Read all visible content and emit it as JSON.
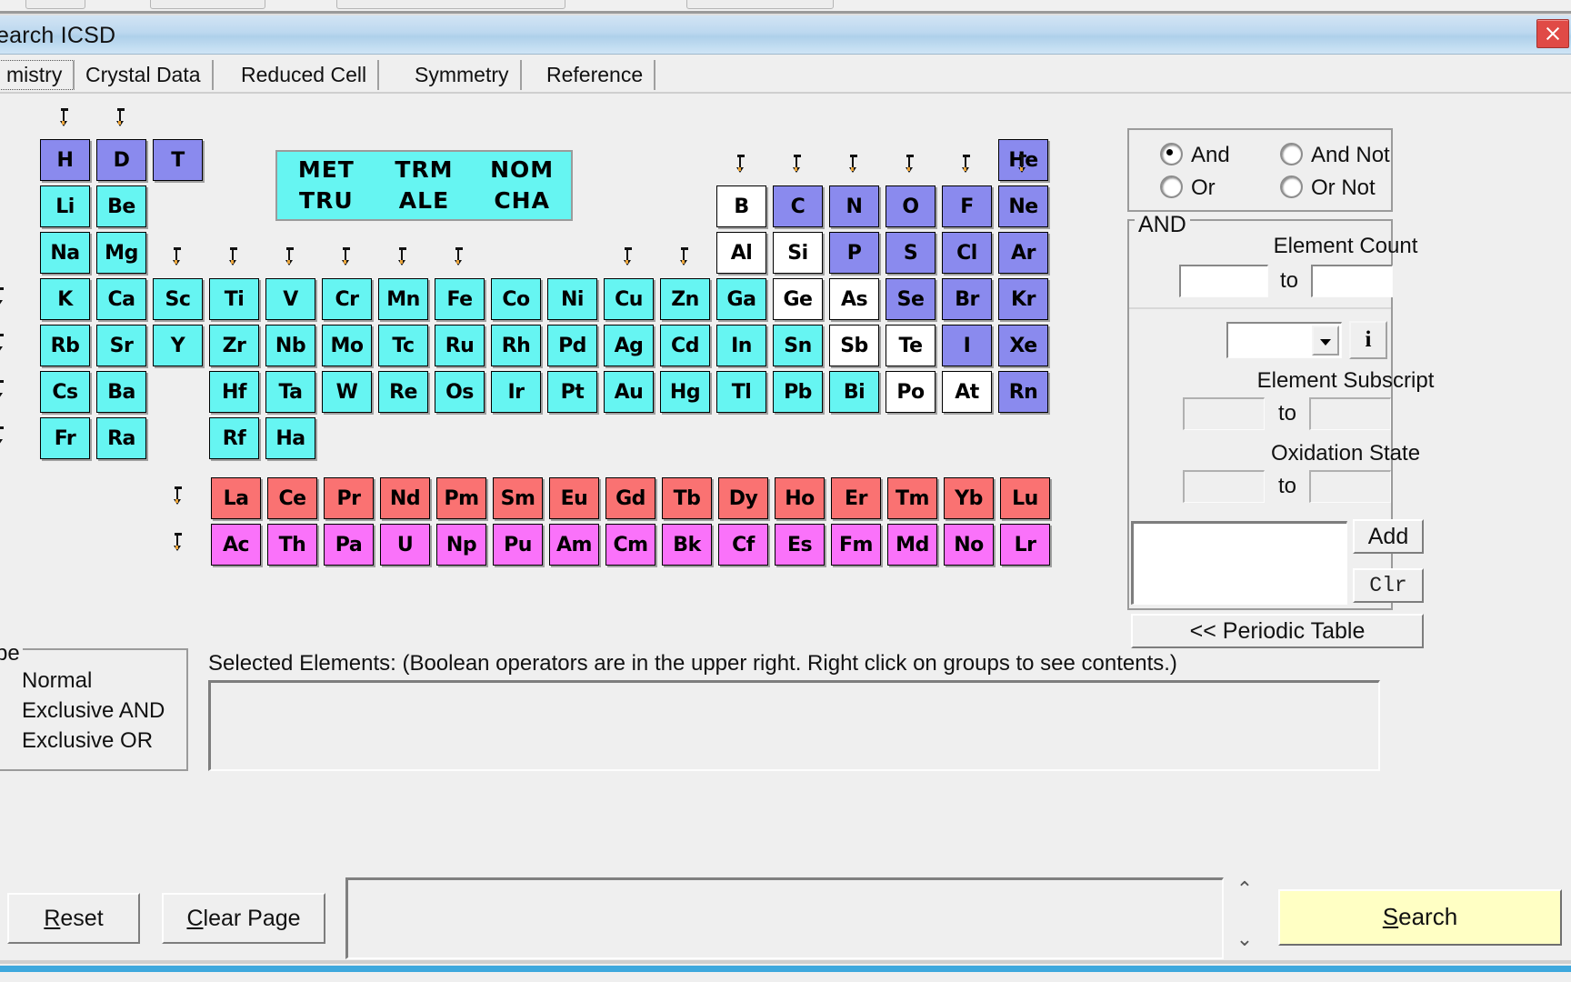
{
  "window": {
    "title": "earch ICSD",
    "close_label": "close-window"
  },
  "tabs": [
    {
      "label": "mistry",
      "selected": true
    },
    {
      "label": "Crystal Data",
      "selected": false
    },
    {
      "label": "Reduced Cell",
      "selected": false
    },
    {
      "label": "Symmetry",
      "selected": false
    },
    {
      "label": "Reference",
      "selected": false
    }
  ],
  "legend": {
    "row1": [
      "MET",
      "TRM",
      "NOM"
    ],
    "row2": [
      "TRU",
      "ALE",
      "CHA"
    ]
  },
  "colors": {
    "cyan": "#66f5f2",
    "blue": "#8a8aee",
    "white": "#ffffff",
    "red": "#fa7272",
    "pink": "#fa72fa",
    "titlebar": "#bcd8ef",
    "search_button": "#ffffc4",
    "close_button": "#e04a46"
  },
  "periodic_table": {
    "rows": [
      {
        "row": 1,
        "cells": [
          {
            "sym": "H",
            "col": 1,
            "color": "blue"
          },
          {
            "sym": "D",
            "col": 2,
            "color": "blue"
          },
          {
            "sym": "T",
            "col": 3,
            "color": "blue"
          },
          {
            "sym": "He",
            "col": 18,
            "color": "blue"
          }
        ]
      },
      {
        "row": 2,
        "cells": [
          {
            "sym": "Li",
            "col": 1,
            "color": "cyan"
          },
          {
            "sym": "Be",
            "col": 2,
            "color": "cyan"
          },
          {
            "sym": "B",
            "col": 13,
            "color": "white"
          },
          {
            "sym": "C",
            "col": 14,
            "color": "blue"
          },
          {
            "sym": "N",
            "col": 15,
            "color": "blue"
          },
          {
            "sym": "O",
            "col": 16,
            "color": "blue"
          },
          {
            "sym": "F",
            "col": 17,
            "color": "blue"
          },
          {
            "sym": "Ne",
            "col": 18,
            "color": "blue"
          }
        ]
      },
      {
        "row": 3,
        "cells": [
          {
            "sym": "Na",
            "col": 1,
            "color": "cyan"
          },
          {
            "sym": "Mg",
            "col": 2,
            "color": "cyan"
          },
          {
            "sym": "Al",
            "col": 13,
            "color": "white"
          },
          {
            "sym": "Si",
            "col": 14,
            "color": "white"
          },
          {
            "sym": "P",
            "col": 15,
            "color": "blue"
          },
          {
            "sym": "S",
            "col": 16,
            "color": "blue"
          },
          {
            "sym": "Cl",
            "col": 17,
            "color": "blue"
          },
          {
            "sym": "Ar",
            "col": 18,
            "color": "blue"
          }
        ]
      },
      {
        "row": 4,
        "cells": [
          {
            "sym": "K",
            "col": 1,
            "color": "cyan"
          },
          {
            "sym": "Ca",
            "col": 2,
            "color": "cyan"
          },
          {
            "sym": "Sc",
            "col": 3,
            "color": "cyan"
          },
          {
            "sym": "Ti",
            "col": 4,
            "color": "cyan"
          },
          {
            "sym": "V",
            "col": 5,
            "color": "cyan"
          },
          {
            "sym": "Cr",
            "col": 6,
            "color": "cyan"
          },
          {
            "sym": "Mn",
            "col": 7,
            "color": "cyan"
          },
          {
            "sym": "Fe",
            "col": 8,
            "color": "cyan"
          },
          {
            "sym": "Co",
            "col": 9,
            "color": "cyan"
          },
          {
            "sym": "Ni",
            "col": 10,
            "color": "cyan"
          },
          {
            "sym": "Cu",
            "col": 11,
            "color": "cyan"
          },
          {
            "sym": "Zn",
            "col": 12,
            "color": "cyan"
          },
          {
            "sym": "Ga",
            "col": 13,
            "color": "cyan"
          },
          {
            "sym": "Ge",
            "col": 14,
            "color": "white"
          },
          {
            "sym": "As",
            "col": 15,
            "color": "white"
          },
          {
            "sym": "Se",
            "col": 16,
            "color": "blue"
          },
          {
            "sym": "Br",
            "col": 17,
            "color": "blue"
          },
          {
            "sym": "Kr",
            "col": 18,
            "color": "blue"
          }
        ]
      },
      {
        "row": 5,
        "cells": [
          {
            "sym": "Rb",
            "col": 1,
            "color": "cyan"
          },
          {
            "sym": "Sr",
            "col": 2,
            "color": "cyan"
          },
          {
            "sym": "Y",
            "col": 3,
            "color": "cyan"
          },
          {
            "sym": "Zr",
            "col": 4,
            "color": "cyan"
          },
          {
            "sym": "Nb",
            "col": 5,
            "color": "cyan"
          },
          {
            "sym": "Mo",
            "col": 6,
            "color": "cyan"
          },
          {
            "sym": "Tc",
            "col": 7,
            "color": "cyan"
          },
          {
            "sym": "Ru",
            "col": 8,
            "color": "cyan"
          },
          {
            "sym": "Rh",
            "col": 9,
            "color": "cyan"
          },
          {
            "sym": "Pd",
            "col": 10,
            "color": "cyan"
          },
          {
            "sym": "Ag",
            "col": 11,
            "color": "cyan"
          },
          {
            "sym": "Cd",
            "col": 12,
            "color": "cyan"
          },
          {
            "sym": "In",
            "col": 13,
            "color": "cyan"
          },
          {
            "sym": "Sn",
            "col": 14,
            "color": "cyan"
          },
          {
            "sym": "Sb",
            "col": 15,
            "color": "white"
          },
          {
            "sym": "Te",
            "col": 16,
            "color": "white"
          },
          {
            "sym": "I",
            "col": 17,
            "color": "blue"
          },
          {
            "sym": "Xe",
            "col": 18,
            "color": "blue"
          }
        ]
      },
      {
        "row": 6,
        "cells": [
          {
            "sym": "Cs",
            "col": 1,
            "color": "cyan"
          },
          {
            "sym": "Ba",
            "col": 2,
            "color": "cyan"
          },
          {
            "sym": "Hf",
            "col": 4,
            "color": "cyan"
          },
          {
            "sym": "Ta",
            "col": 5,
            "color": "cyan"
          },
          {
            "sym": "W",
            "col": 6,
            "color": "cyan"
          },
          {
            "sym": "Re",
            "col": 7,
            "color": "cyan"
          },
          {
            "sym": "Os",
            "col": 8,
            "color": "cyan"
          },
          {
            "sym": "Ir",
            "col": 9,
            "color": "cyan"
          },
          {
            "sym": "Pt",
            "col": 10,
            "color": "cyan"
          },
          {
            "sym": "Au",
            "col": 11,
            "color": "cyan"
          },
          {
            "sym": "Hg",
            "col": 12,
            "color": "cyan"
          },
          {
            "sym": "Tl",
            "col": 13,
            "color": "cyan"
          },
          {
            "sym": "Pb",
            "col": 14,
            "color": "cyan"
          },
          {
            "sym": "Bi",
            "col": 15,
            "color": "cyan"
          },
          {
            "sym": "Po",
            "col": 16,
            "color": "white"
          },
          {
            "sym": "At",
            "col": 17,
            "color": "white"
          },
          {
            "sym": "Rn",
            "col": 18,
            "color": "blue"
          }
        ]
      },
      {
        "row": 7,
        "cells": [
          {
            "sym": "Fr",
            "col": 1,
            "color": "cyan"
          },
          {
            "sym": "Ra",
            "col": 2,
            "color": "cyan"
          },
          {
            "sym": "Rf",
            "col": 4,
            "color": "cyan"
          },
          {
            "sym": "Ha",
            "col": 5,
            "color": "cyan"
          }
        ]
      }
    ],
    "lanthanides": [
      "La",
      "Ce",
      "Pr",
      "Nd",
      "Pm",
      "Sm",
      "Eu",
      "Gd",
      "Tb",
      "Dy",
      "Ho",
      "Er",
      "Tm",
      "Yb",
      "Lu"
    ],
    "actinides": [
      "Ac",
      "Th",
      "Pa",
      "U",
      "Np",
      "Pu",
      "Am",
      "Cm",
      "Bk",
      "Cf",
      "Es",
      "Fm",
      "Md",
      "No",
      "Lr"
    ],
    "lanthanide_color": "red",
    "actinide_color": "pink",
    "group_arrow_cols": [
      1,
      2,
      13,
      14,
      15,
      16,
      17,
      18,
      3,
      4,
      5,
      6,
      7,
      8,
      11,
      12
    ],
    "period_arrow_rows": [
      4,
      5,
      6,
      7
    ]
  },
  "boolean_operators": {
    "options": [
      {
        "label": "And",
        "selected": true
      },
      {
        "label": "And Not",
        "selected": false
      },
      {
        "label": "Or",
        "selected": false
      },
      {
        "label": "Or Not",
        "selected": false
      }
    ]
  },
  "and_group": {
    "legend": "AND",
    "element_count": {
      "label": "Element Count",
      "from": "",
      "to_word": "to",
      "to": ""
    },
    "element_select": {
      "value": "",
      "info_button": "i"
    },
    "element_subscript": {
      "label": "Element Subscript",
      "from": "",
      "to_word": "to",
      "to": "",
      "disabled": true
    },
    "oxidation_state": {
      "label": "Oxidation State",
      "from": "",
      "to_word": "to",
      "to": "",
      "disabled": true
    },
    "query_box": {
      "value": ""
    },
    "add_button": "Add",
    "clr_button": "Clr"
  },
  "periodic_table_button": "<< Periodic Table",
  "search_type": {
    "legend": "pe",
    "options": [
      {
        "label": "Normal",
        "selected": false
      },
      {
        "label": "Exclusive AND",
        "selected": false
      },
      {
        "label": "Exclusive OR",
        "selected": false
      }
    ]
  },
  "selected_elements": {
    "label": "Selected Elements: (Boolean operators are in the upper right.  Right click on groups to see contents.)",
    "value": ""
  },
  "footer": {
    "reset_button": {
      "prefix": "",
      "accel": "R",
      "suffix": "eset"
    },
    "clear_page_button": {
      "prefix": "",
      "accel": "C",
      "mid": "lear Pa",
      "accel2": "g",
      "suffix": "e"
    },
    "message_box": {
      "value": ""
    },
    "scroll_up": "⌃",
    "scroll_down": "⌄",
    "search_button": {
      "prefix": "",
      "accel": "S",
      "suffix": "earch"
    }
  }
}
